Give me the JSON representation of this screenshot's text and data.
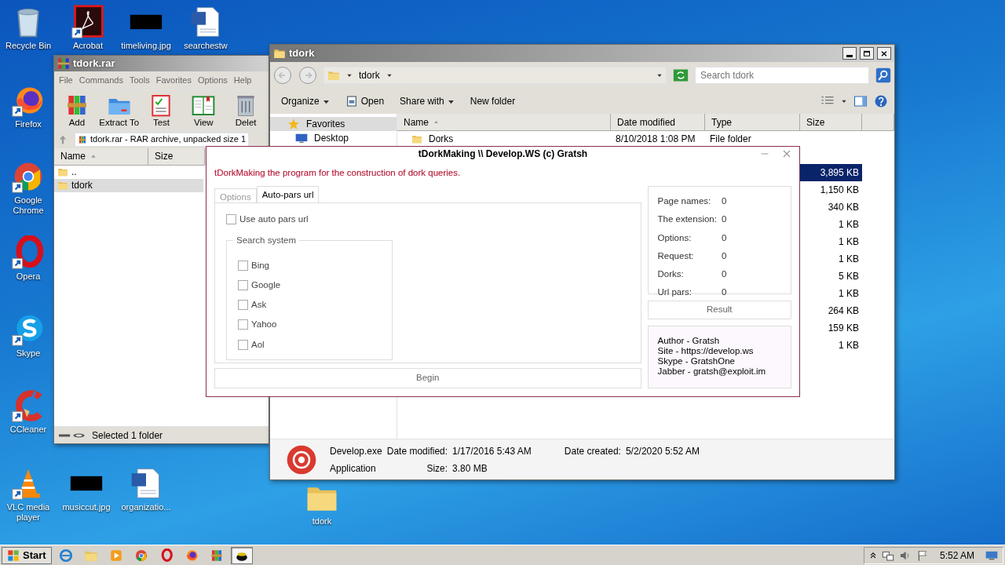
{
  "desktop_icons": [
    {
      "label": "Recycle Bin",
      "kind": "trash",
      "shortcut": false
    },
    {
      "label": "Acrobat",
      "kind": "pdf",
      "shortcut": true
    },
    {
      "label": "timeliving.jpg",
      "kind": "image",
      "shortcut": false
    },
    {
      "label": "searchestw",
      "kind": "doc",
      "shortcut": false
    },
    {
      "label": "Firefox",
      "kind": "firefox",
      "shortcut": true
    },
    {
      "label": "Google Chrome",
      "kind": "chrome",
      "shortcut": true
    },
    {
      "label": "Opera",
      "kind": "opera",
      "shortcut": true
    },
    {
      "label": "Skype",
      "kind": "skype",
      "shortcut": true
    },
    {
      "label": "CCleaner",
      "kind": "ccleaner",
      "shortcut": true
    },
    {
      "label": "VLC media player",
      "kind": "vlc",
      "shortcut": true
    },
    {
      "label": "musiccut.jpg",
      "kind": "image",
      "shortcut": false
    },
    {
      "label": "organizatio...",
      "kind": "doc",
      "shortcut": false
    },
    {
      "label": "tdork",
      "kind": "folder",
      "shortcut": false
    }
  ],
  "archive_window": {
    "title": "tdork.rar",
    "menu": [
      "File",
      "Commands",
      "Tools",
      "Favorites",
      "Options",
      "Help"
    ],
    "toolbar": [
      {
        "label": "Add",
        "kind": "add"
      },
      {
        "label": "Extract To",
        "kind": "extract"
      },
      {
        "label": "Test",
        "kind": "test"
      },
      {
        "label": "View",
        "kind": "view"
      },
      {
        "label": "Delet",
        "kind": "delete"
      }
    ],
    "path": "tdork.rar - RAR archive, unpacked size 1",
    "columns": [
      "Name",
      "Size"
    ],
    "rows": [
      {
        "name": "..",
        "selected": false
      },
      {
        "name": "tdork",
        "selected": true
      }
    ],
    "status": "Selected 1 folder"
  },
  "explorer_window": {
    "title": "tdork",
    "address": "tdork",
    "search": {
      "placeholder": "Search tdork"
    },
    "commands": [
      {
        "label": "Organize",
        "kind": "menu"
      },
      {
        "label": "Open",
        "kind": "open"
      },
      {
        "label": "Share with",
        "kind": "menu"
      },
      {
        "label": "New folder",
        "kind": "plain"
      }
    ],
    "nav": [
      {
        "label": "Favorites",
        "kind": "star"
      },
      {
        "label": "Desktop",
        "kind": "desktop"
      }
    ],
    "columns": [
      "Name",
      "Date modified",
      "Type",
      "Size"
    ],
    "rows": [
      {
        "name": "Dorks",
        "date_modified": "8/10/2018 1:08 PM",
        "type": "File folder",
        "selected": false
      },
      {
        "selected": false
      },
      {
        "size": "3,895 KB",
        "selected": true
      },
      {
        "size": "1,150 KB",
        "selected": false
      },
      {
        "size": "340 KB",
        "selected": false
      },
      {
        "size": "1 KB",
        "selected": false
      },
      {
        "size": "1 KB",
        "selected": false
      },
      {
        "size": "1 KB",
        "selected": false
      },
      {
        "size": "5 KB",
        "selected": false
      },
      {
        "size": "1 KB",
        "selected": false
      },
      {
        "size": "264 KB",
        "selected": false
      },
      {
        "size": "159 KB",
        "selected": false
      },
      {
        "size": "1 KB",
        "selected": false
      }
    ],
    "details": {
      "name": "Develop.exe",
      "type": "Application",
      "fields": [
        {
          "label": "Date modified:",
          "value": "1/17/2016 5:43 AM"
        },
        {
          "label": "Date created:",
          "value": "5/2/2020 5:52 AM"
        },
        {
          "label": "Size:",
          "value": "3.80 MB"
        }
      ]
    }
  },
  "dialog": {
    "title": "tDorkMaking \\\\ Develop.WS (c) Gratsh",
    "subtitle": "tDorkMaking the program for the construction of dork queries.",
    "tabs": [
      {
        "label": "Options",
        "selected": false
      },
      {
        "label": "Auto-pars url",
        "selected": true
      }
    ],
    "auto_pars": {
      "label": "Use auto pars url",
      "checked": false
    },
    "search_system": {
      "title": "Search system",
      "engines": [
        {
          "label": "Bing",
          "checked": false
        },
        {
          "label": "Google",
          "checked": false
        },
        {
          "label": "Ask",
          "checked": false
        },
        {
          "label": "Yahoo",
          "checked": false
        },
        {
          "label": "Aol",
          "checked": false
        }
      ]
    },
    "stats": [
      {
        "label": "Page names:",
        "value": "0"
      },
      {
        "label": "The extension:",
        "value": "0"
      },
      {
        "label": "Options:",
        "value": "0"
      },
      {
        "label": "Request:",
        "value": "0"
      },
      {
        "label": "Dorks:",
        "value": "0"
      },
      {
        "label": "Url pars:",
        "value": "0"
      }
    ],
    "result_button": "Result",
    "begin_button": "Begin",
    "about": [
      "Author - Gratsh",
      "Site - https://develop.ws",
      "Skype - GratshOne",
      "Jabber - gratsh@exploit.im"
    ]
  },
  "taskbar": {
    "start": "Start",
    "items": [
      {
        "kind": "ie",
        "active": false
      },
      {
        "kind": "explorer",
        "active": false
      },
      {
        "kind": "media",
        "active": false
      },
      {
        "kind": "chrome",
        "active": false
      },
      {
        "kind": "opera",
        "active": false
      },
      {
        "kind": "firefox",
        "active": false
      },
      {
        "kind": "winrar",
        "active": false
      },
      {
        "kind": "app",
        "active": true
      }
    ],
    "time": "5:52 AM"
  }
}
